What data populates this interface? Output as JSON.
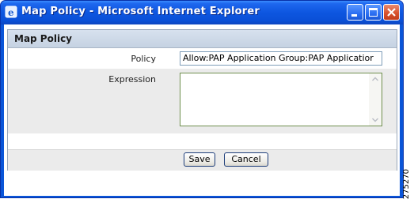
{
  "window": {
    "title": "Map Policy - Microsoft Internet Explorer",
    "controls": {
      "minimize_icon": "minimize-icon",
      "maximize_icon": "maximize-icon",
      "close_icon": "close-icon"
    },
    "accent": "#0a55d8"
  },
  "panel": {
    "title": "Map Policy",
    "policy_label": "Policy",
    "policy_value": "Allow:PAP Application Group:PAP Applicatior",
    "expression_label": "Expression",
    "expression_value": ""
  },
  "buttons": {
    "save": "Save",
    "cancel": "Cancel"
  },
  "figure_id": "275270"
}
